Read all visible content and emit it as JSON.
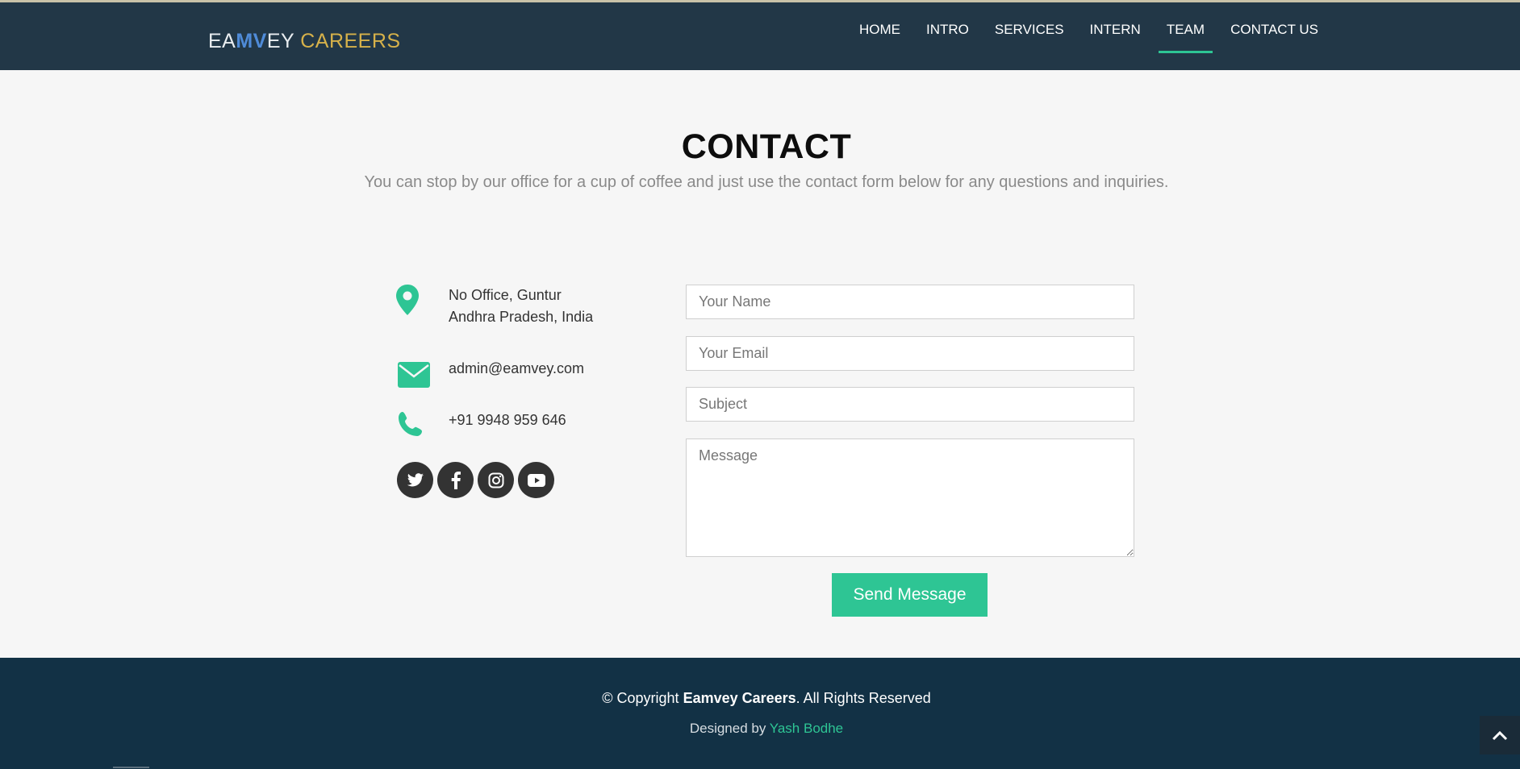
{
  "header": {
    "logo": {
      "part1": "EA",
      "mark": "MV",
      "part2": "EY",
      "accent": " CAREERS"
    },
    "nav": [
      {
        "label": "HOME"
      },
      {
        "label": "INTRO"
      },
      {
        "label": "SERVICES"
      },
      {
        "label": "INTERN"
      },
      {
        "label": "TEAM",
        "active": true
      },
      {
        "label": "CONTACT US"
      }
    ]
  },
  "contact": {
    "title": "CONTACT",
    "subtitle": "You can stop by our office for a cup of coffee and just use the contact form below for any questions and inquiries.",
    "address_line1": "No Office, Guntur",
    "address_line2": "Andhra Pradesh, India",
    "email": "admin@eamvey.com",
    "phone": "+91 9948 959 646",
    "socials": [
      "twitter-icon",
      "facebook-icon",
      "instagram-icon",
      "youtube-icon"
    ]
  },
  "form": {
    "name_placeholder": "Your Name",
    "email_placeholder": "Your Email",
    "subject_placeholder": "Subject",
    "message_placeholder": "Message",
    "send_label": "Send Message"
  },
  "footer": {
    "copyright_prefix": "© Copyright ",
    "company": "Eamvey Careers",
    "copyright_suffix": ". All Rights Reserved",
    "designed_by": "Designed by ",
    "designer": "Yash Bodhe"
  },
  "colors": {
    "accent": "#2ec594",
    "header_bg": "#223747",
    "footer_bg": "#123145",
    "logo_accent": "#d6b14a"
  }
}
